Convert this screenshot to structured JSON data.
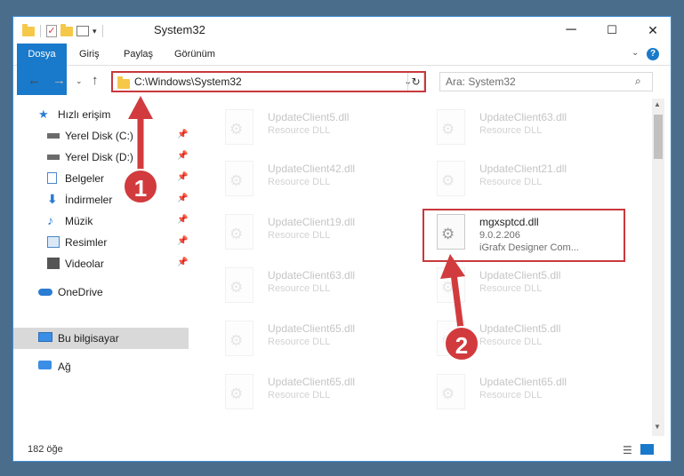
{
  "window": {
    "title": "System32",
    "minimize": "─",
    "maximize": "☐",
    "close": "✕"
  },
  "ribbon": {
    "tabs": [
      "Dosya",
      "Giriş",
      "Paylaş",
      "Görünüm"
    ],
    "help": "?"
  },
  "address": {
    "path": "C:\\Windows\\System32",
    "dropdown": "⌄",
    "refresh": "↻"
  },
  "search": {
    "placeholder": "Ara: System32"
  },
  "nav": {
    "items": [
      {
        "label": "Hızlı erişim",
        "icon": "star-icon",
        "color": "#2b7cd3"
      },
      {
        "label": "Yerel Disk (C:)",
        "icon": "drive-icon",
        "color": "#6b6b6b",
        "pinned": true
      },
      {
        "label": "Yerel Disk (D:)",
        "icon": "drive-icon",
        "color": "#6b6b6b",
        "pinned": true
      },
      {
        "label": "Belgeler",
        "icon": "documents-icon",
        "color": "#4a86c8",
        "pinned": true
      },
      {
        "label": "İndirmeler",
        "icon": "download-icon",
        "color": "#2b7cd3",
        "pinned": true
      },
      {
        "label": "Müzik",
        "icon": "music-icon",
        "color": "#2b7cd3",
        "pinned": true
      },
      {
        "label": "Resimler",
        "icon": "pictures-icon",
        "color": "#4a86c8",
        "pinned": true
      },
      {
        "label": "Videolar",
        "icon": "videos-icon",
        "color": "#555555",
        "pinned": true
      },
      {
        "label": "OneDrive",
        "icon": "cloud-icon",
        "color": "#2b7cd3"
      },
      {
        "label": "Bu bilgisayar",
        "icon": "computer-icon",
        "color": "#3a8ee6",
        "selected": true
      },
      {
        "label": "Ağ",
        "icon": "network-icon",
        "color": "#3a8ee6"
      }
    ],
    "pin_glyph": "📌"
  },
  "files": [
    {
      "name": "UpdateClient5.dll",
      "desc": "Resource DLL"
    },
    {
      "name": "UpdateClient63.dll",
      "desc": "Resource DLL"
    },
    {
      "name": "UpdateClient42.dll",
      "desc": "Resource DLL"
    },
    {
      "name": "UpdateClient21.dll",
      "desc": "Resource DLL"
    },
    {
      "name": "UpdateClient19.dll",
      "desc": "Resource DLL"
    },
    {
      "name": "mgxsptcd.dll",
      "desc": "9.0.2.206",
      "desc2": "iGrafx Designer Com...",
      "highlight": true
    },
    {
      "name": "UpdateClient63.dll",
      "desc": "Resource DLL"
    },
    {
      "name": "UpdateClient5.dll",
      "desc": "Resource DLL"
    },
    {
      "name": "UpdateClient65.dll",
      "desc": "Resource DLL"
    },
    {
      "name": "UpdateClient5.dll",
      "desc": "Resource DLL"
    },
    {
      "name": "UpdateClient65.dll",
      "desc": "Resource DLL"
    },
    {
      "name": "UpdateClient65.dll",
      "desc": "Resource DLL"
    }
  ],
  "status": {
    "count": "182 öğe"
  },
  "annotations": {
    "badge1": "1",
    "badge2": "2",
    "color": "#d23b3e"
  }
}
